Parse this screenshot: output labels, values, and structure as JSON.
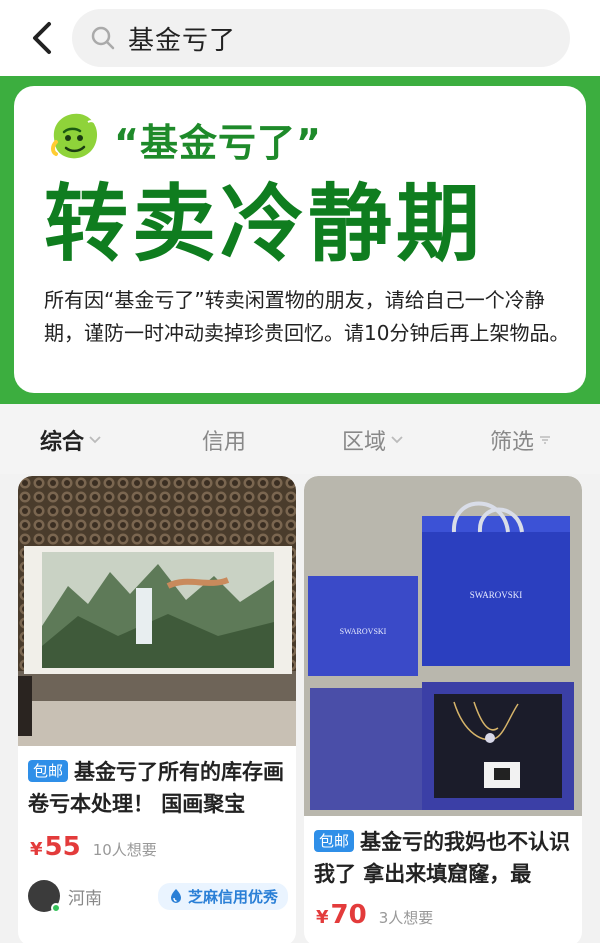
{
  "search": {
    "query": "基金亏了"
  },
  "banner": {
    "quote_title": "“基金亏了”",
    "big_title": "转卖冷静期",
    "description": "所有因“基金亏了”转卖闲置物的朋友，请给自己一个冷静期，谨防一时冲动卖掉珍贵回忆。请10分钟后再上架物品。"
  },
  "filters": [
    {
      "label": "综合",
      "active": true,
      "icon": "chevron-down-icon"
    },
    {
      "label": "信用",
      "active": false
    },
    {
      "label": "区域",
      "active": false,
      "icon": "chevron-down-icon"
    },
    {
      "label": "筛选",
      "active": false,
      "icon": "filter-icon"
    }
  ],
  "products": [
    {
      "badge": "包邮",
      "title": "基金亏了所有的库存画卷亏本处理！ 国画聚宝",
      "price": "55",
      "currency": "¥",
      "wants": "10人想要",
      "location": "河南",
      "credit": "芝麻信用优秀"
    },
    {
      "badge": "包邮",
      "title": "基金亏的我妈也不认识我了 拿出来填窟窿，最",
      "price": "70",
      "currency": "¥",
      "wants": "3人想要",
      "box_brand": "SWAROVSKI",
      "bag_brand": "SWAROVSKI"
    }
  ],
  "colors": {
    "brand_green": "#3cae3f",
    "title_green": "#0f7d1f",
    "price_red": "#e33b3b",
    "badge_blue": "#2f8fe8",
    "credit_blue": "#2a7fd6"
  }
}
